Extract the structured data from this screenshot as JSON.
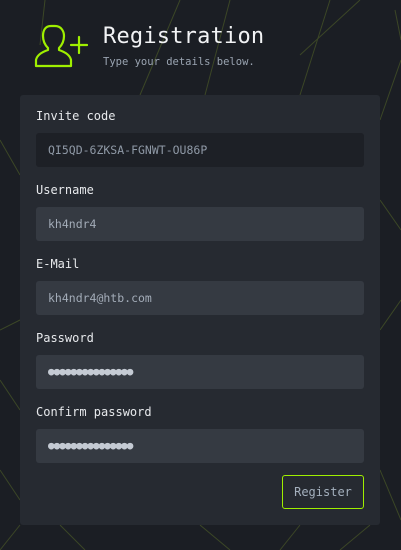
{
  "header": {
    "title": "Registration",
    "subtitle": "Type your details below."
  },
  "form": {
    "invite_code": {
      "label": "Invite code",
      "value": "QI5QD-6ZKSA-FGNWT-OU86P"
    },
    "username": {
      "label": "Username",
      "value": "kh4ndr4"
    },
    "email": {
      "label": "E-Mail",
      "value": "kh4ndr4@htb.com"
    },
    "password": {
      "label": "Password",
      "value": "●●●●●●●●●●●●●●●"
    },
    "confirm_password": {
      "label": "Confirm password",
      "value": "●●●●●●●●●●●●●●●"
    },
    "register_label": "Register"
  },
  "icons": {
    "header_icon": "add-user-icon"
  },
  "colors": {
    "accent": "#9fef00",
    "background": "#1b1e24",
    "card": "#262a31"
  }
}
